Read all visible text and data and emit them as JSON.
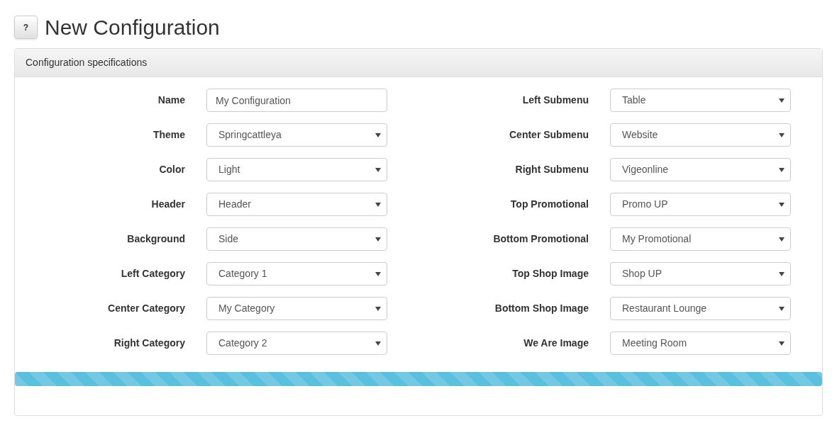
{
  "help_button": "?",
  "title": "New Configuration",
  "panel": {
    "heading": "Configuration specifications",
    "left_fields": [
      {
        "label": "Name",
        "kind": "text",
        "value": "My Configuration"
      },
      {
        "label": "Theme",
        "kind": "select",
        "value": "Springcattleya"
      },
      {
        "label": "Color",
        "kind": "select",
        "value": "Light"
      },
      {
        "label": "Header",
        "kind": "select",
        "value": "Header"
      },
      {
        "label": "Background",
        "kind": "select",
        "value": "Side"
      },
      {
        "label": "Left Category",
        "kind": "select",
        "value": "Category 1"
      },
      {
        "label": "Center Category",
        "kind": "select",
        "value": "My Category"
      },
      {
        "label": "Right Category",
        "kind": "select",
        "value": "Category 2"
      }
    ],
    "right_fields": [
      {
        "label": "Left Submenu",
        "kind": "select",
        "value": "Table"
      },
      {
        "label": "Center Submenu",
        "kind": "select",
        "value": "Website"
      },
      {
        "label": "Right Submenu",
        "kind": "select",
        "value": "Vigeonline"
      },
      {
        "label": "Top Promotional",
        "kind": "select",
        "value": "Promo UP"
      },
      {
        "label": "Bottom Promotional",
        "kind": "select",
        "value": "My Promotional"
      },
      {
        "label": "Top Shop Image",
        "kind": "select",
        "value": "Shop UP"
      },
      {
        "label": "Bottom Shop Image",
        "kind": "select",
        "value": "Restaurant Lounge"
      },
      {
        "label": "We Are Image",
        "kind": "select",
        "value": "Meeting Room"
      }
    ],
    "progress": {
      "level": 1
    }
  }
}
